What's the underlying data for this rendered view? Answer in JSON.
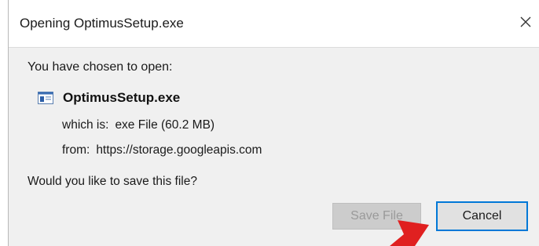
{
  "window": {
    "title": "Opening OptimusSetup.exe",
    "close_glyph": "X"
  },
  "content": {
    "intro": "You have chosen to open:",
    "file_icon": "exe-file-icon",
    "file_name": "OptimusSetup.exe",
    "type_label": "which is:",
    "type_value": "exe File (60.2 MB)",
    "from_label": "from:",
    "from_value": "https://storage.googleapis.com",
    "question": "Would you like to save this file?"
  },
  "buttons": {
    "save_label": "Save File",
    "save_state": "disabled",
    "cancel_label": "Cancel"
  },
  "colors": {
    "focus_border": "#0078d7",
    "annotation_arrow": "#e02020"
  }
}
